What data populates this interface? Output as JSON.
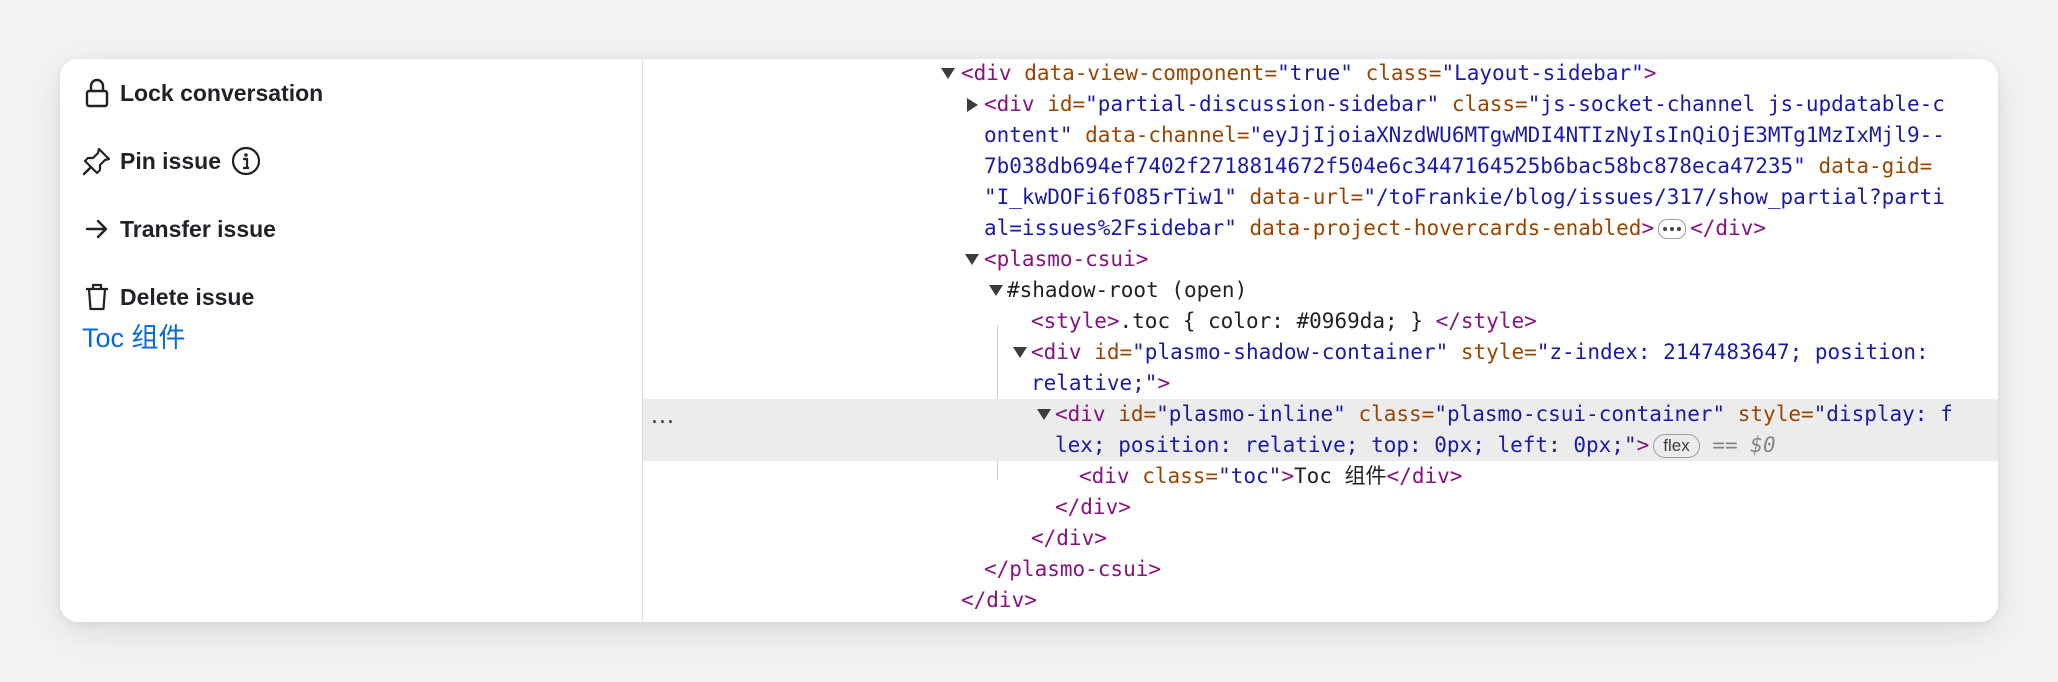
{
  "sidebar_actions": {
    "lock": {
      "label": "Lock conversation",
      "icon": "lock-icon"
    },
    "pin": {
      "label": "Pin issue",
      "icon": "pin-icon",
      "info_icon": "info-icon"
    },
    "transfer": {
      "label": "Transfer issue",
      "icon": "arrow-right-icon"
    },
    "delete": {
      "label": "Delete issue",
      "icon": "trash-icon"
    }
  },
  "toc_link": "Toc 组件",
  "colors": {
    "accent": "#0969da",
    "tag": "#881280",
    "attr_name": "#994500",
    "attr_value": "#1a1aa6",
    "selected_row": "#ececec"
  },
  "devtools": {
    "l1": {
      "open": "<div",
      "a1": " data-view-component=",
      "v1": "\"true\"",
      "a2": " class=",
      "v2": "\"Layout-sidebar\"",
      "close": ">"
    },
    "l2": {
      "open": "<div",
      "a1": " id=",
      "v1": "\"partial-discussion-sidebar\"",
      "a2": " class=",
      "v2": "\"js-socket-channel js-updatable-c"
    },
    "l3": {
      "v2": "ontent\"",
      "a3": " data-channel=",
      "v3": "\"eyJjIjoiaXNzdWU6MTgwMDI4NTIzNyIsInQiOjE3MTg1MzIxMjl9--"
    },
    "l4": {
      "v3": "7b038db694ef7402f2718814672f504e6c3447164525b6bac58bc878eca47235\"",
      "a4": " data-gid="
    },
    "l5": {
      "v4": "\"I_kwDOFi6fO85rTiw1\"",
      "a5": " data-url=",
      "v5": "\"/toFrankie/blog/issues/317/show_partial?parti"
    },
    "l6": {
      "v5": "al=issues%2Fsidebar\"",
      "a6": " data-project-hovercards-enabled",
      "close": ">",
      "end": "</div>"
    },
    "l7": {
      "open": "<plasmo-csui>"
    },
    "l8": {
      "text": "#shadow-root (open)"
    },
    "l9": {
      "open": "<style>",
      "text": ".toc { color: #0969da; } ",
      "end": "</style>"
    },
    "l10": {
      "open": "<div",
      "a1": " id=",
      "v1": "\"plasmo-shadow-container\"",
      "a2": " style=",
      "v2": "\"z-index: 2147483647; position:"
    },
    "l11": {
      "v2": "relative;\"",
      "close": ">"
    },
    "l12": {
      "open": "<div",
      "a1": " id=",
      "v1": "\"plasmo-inline\"",
      "a2": " class=",
      "v2": "\"plasmo-csui-container\"",
      "a3": " style=",
      "v3": "\"display: f"
    },
    "l13": {
      "v3": "lex; position: relative; top: 0px; left: 0px;\"",
      "close": ">",
      "badge": "flex",
      "eq": " == ",
      "sel": "$0"
    },
    "l14": {
      "open": "<div",
      "a1": " class=",
      "v1": "\"toc\"",
      "close": ">",
      "text": "Toc 组件",
      "end": "</div>"
    },
    "l15": {
      "end": "</div>"
    },
    "l16": {
      "end": "</div>"
    },
    "l17": {
      "end": "</plasmo-csui>"
    },
    "l18": {
      "end": "</div>"
    },
    "row_menu": "..."
  }
}
